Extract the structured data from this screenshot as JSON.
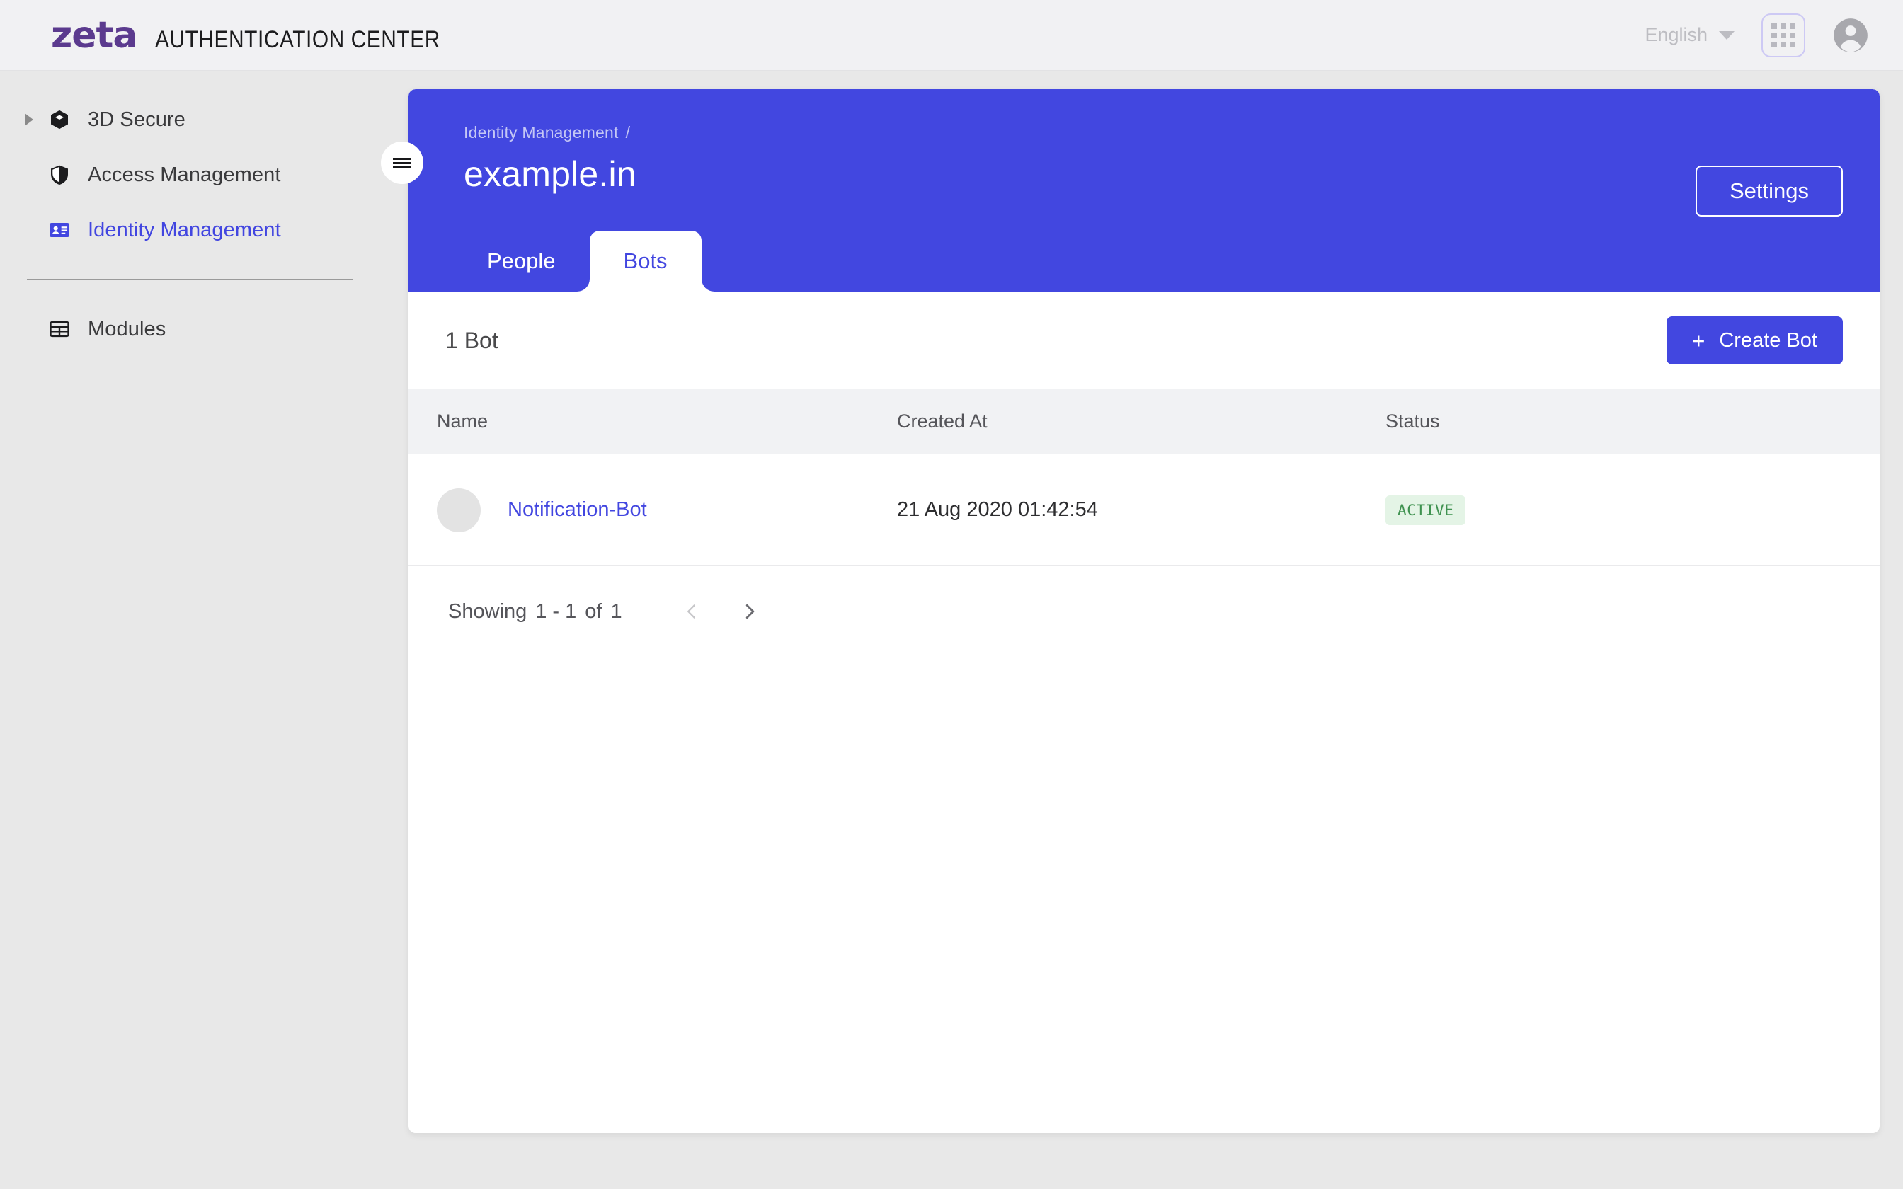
{
  "header": {
    "logo_text": "zeta",
    "app_title": "AUTHENTICATION CENTER",
    "language": "English",
    "language_icon": "chevron-down-icon",
    "apps_icon": "apps-grid-icon",
    "account_icon": "user-avatar-icon"
  },
  "sidebar": {
    "toggle_icon": "hamburger-menu-icon",
    "items": [
      {
        "label": "3D Secure",
        "icon": "cube-icon",
        "expandable": true,
        "active": false
      },
      {
        "label": "Access Management",
        "icon": "shield-icon",
        "expandable": false,
        "active": false
      },
      {
        "label": "Identity Management",
        "icon": "id-card-icon",
        "expandable": false,
        "active": true
      }
    ],
    "items_secondary": [
      {
        "label": "Modules",
        "icon": "grid-table-icon",
        "expandable": false,
        "active": false
      }
    ]
  },
  "panel": {
    "breadcrumb_parent": "Identity Management",
    "breadcrumb_separator": "/",
    "title": "example.in",
    "settings_label": "Settings",
    "tabs": [
      {
        "label": "People",
        "active": false
      },
      {
        "label": "Bots",
        "active": true
      }
    ]
  },
  "toolbar": {
    "count_label": "1 Bot",
    "create_plus": "+",
    "create_label": "Create Bot"
  },
  "table": {
    "columns": [
      "Name",
      "Created At",
      "Status"
    ],
    "rows": [
      {
        "avatar": "bot-avatar",
        "name": "Notification-Bot",
        "created_at": "21 Aug 2020 01:42:54",
        "status": "ACTIVE"
      }
    ]
  },
  "pagination": {
    "showing_word": "Showing",
    "range": "1 - 1",
    "of_word": "of",
    "total": "1",
    "prev_icon": "chevron-left-icon",
    "next_icon": "chevron-right-icon"
  },
  "colors": {
    "brand_purple": "#5b3a8e",
    "accent_blue": "#4247e0",
    "status_green_text": "#3f9250",
    "status_green_bg": "#e4f4e6",
    "page_bg": "#e8e8e8"
  }
}
